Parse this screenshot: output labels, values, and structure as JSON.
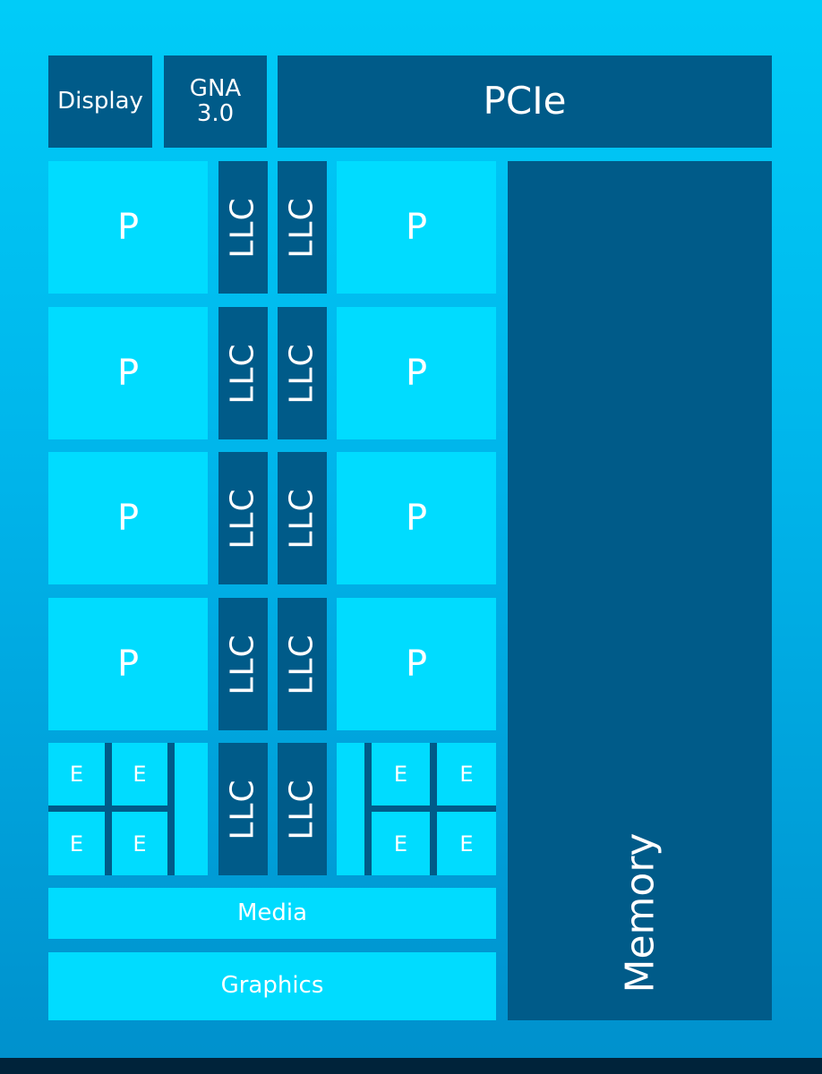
{
  "top_row": {
    "display": "Display",
    "gna_line1": "GNA",
    "gna_line2": "3.0",
    "pcie": "PCIe"
  },
  "cores": {
    "p_label": "P",
    "e_label": "E",
    "llc_label": "LLC",
    "p_core_rows": 4,
    "e_cores_per_cluster": 4,
    "e_clusters": 2
  },
  "bottom": {
    "media": "Media",
    "graphics": "Graphics"
  },
  "memory": "Memory",
  "colors": {
    "background": "#00ccf8",
    "dark_block": "#005b89",
    "light_block": "#00dcff",
    "text": "#ffffff"
  }
}
